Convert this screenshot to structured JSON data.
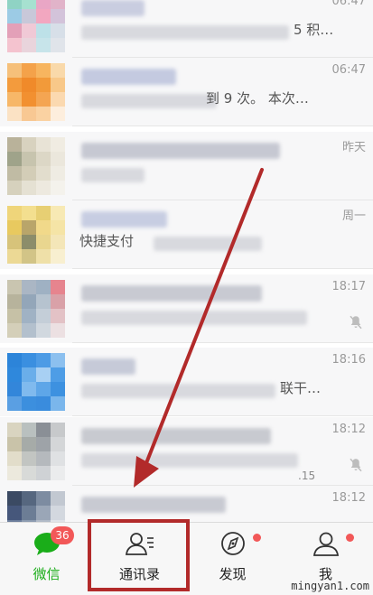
{
  "chat_list": {
    "rows": [
      {
        "time": "06:47",
        "preview": "5 积…"
      },
      {
        "time": "06:47",
        "preview": "到 9 次。 本次…"
      },
      {
        "time": "昨天",
        "preview": ""
      },
      {
        "time": "周一",
        "preview": "快捷支付"
      },
      {
        "time": "18:17",
        "preview": ""
      },
      {
        "time": "18:16",
        "preview": "联干…"
      },
      {
        "time": "18:12",
        "preview": ""
      },
      {
        "time": "18:12",
        "preview": ""
      }
    ],
    "extra_text": ".15"
  },
  "tabbar": {
    "tabs": [
      {
        "label": "微信",
        "badge": "36",
        "active": true
      },
      {
        "label": "通讯录"
      },
      {
        "label": "发现"
      },
      {
        "label": "我"
      }
    ]
  },
  "annotation": {
    "color": "#b22a2a"
  },
  "colors": {
    "accent": "#1aad19",
    "badge": "#f25858"
  },
  "watermark": "mingyan1.com"
}
